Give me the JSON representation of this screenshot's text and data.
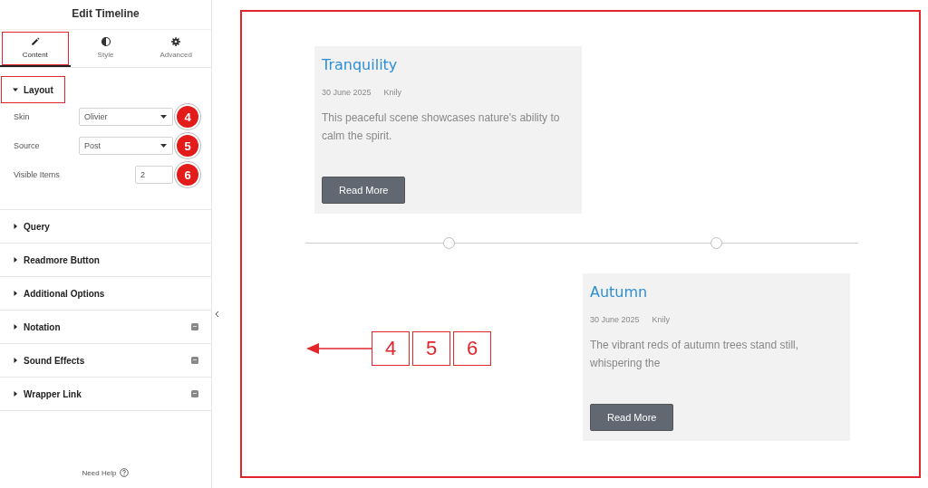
{
  "panel": {
    "title": "Edit Timeline",
    "tabs": [
      {
        "label": "Content",
        "selected": true,
        "highlighted": true
      },
      {
        "label": "Style",
        "selected": false,
        "highlighted": false
      },
      {
        "label": "Advanced",
        "selected": false,
        "highlighted": false
      }
    ],
    "layout": {
      "title": "Layout",
      "expanded": true,
      "highlighted": true,
      "fields": [
        {
          "kind": "select",
          "label": "Skin",
          "value": "Olivier",
          "marker": "4"
        },
        {
          "kind": "select",
          "label": "Source",
          "value": "Post",
          "marker": "5"
        },
        {
          "kind": "number",
          "label": "Visible Items",
          "value": "2",
          "marker": "6"
        }
      ]
    },
    "sections": [
      {
        "title": "Query",
        "pro": false
      },
      {
        "title": "Readmore Button",
        "pro": false
      },
      {
        "title": "Additional Options",
        "pro": false
      },
      {
        "title": "Notation",
        "pro": true
      },
      {
        "title": "Sound Effects",
        "pro": true
      },
      {
        "title": "Wrapper Link",
        "pro": true
      }
    ],
    "help": "Need Help"
  },
  "timeline": {
    "items": [
      {
        "title": "Tranquility",
        "date": "30 June 2025",
        "author": "Knily",
        "excerpt": "This peaceful scene showcases nature's ability to calm the spirit.",
        "button": "Read More"
      },
      {
        "title": "Autumn",
        "date": "30 June 2025",
        "author": "Knily",
        "excerpt": "The vibrant reds of autumn trees stand still, whispering the",
        "button": "Read More"
      }
    ]
  },
  "callout": {
    "labels": [
      "4",
      "5",
      "6"
    ]
  }
}
